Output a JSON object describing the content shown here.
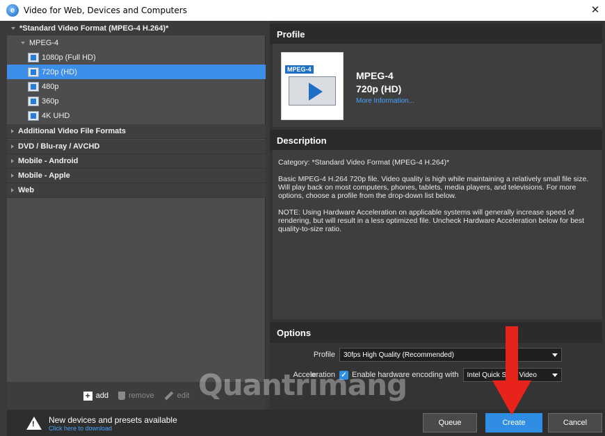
{
  "window": {
    "title": "Video for Web, Devices and Computers"
  },
  "tree": {
    "category_main": "*Standard Video Format (MPEG-4 H.264)*",
    "group": "MPEG-4",
    "presets": [
      "1080p (Full HD)",
      "720p (HD)",
      "480p",
      "360p",
      "4K UHD"
    ],
    "selected_index": 1,
    "other_categories": [
      "Additional Video File Formats",
      "DVD / Blu-ray / AVCHD",
      "Mobile - Android",
      "Mobile - Apple",
      "Web"
    ]
  },
  "left_footer": {
    "add": "add",
    "remove": "remove",
    "edit": "edit"
  },
  "profile": {
    "header": "Profile",
    "thumb_label": "MPEG-4",
    "name": "MPEG-4",
    "subname": "720p (HD)",
    "more_link": "More Information..."
  },
  "description": {
    "header": "Description",
    "category": "Category: *Standard Video Format (MPEG-4 H.264)*",
    "body": "Basic MPEG-4 H.264 720p file. Video quality is high while maintaining a relatively small file size. Will play back on most computers, phones, tablets, media players, and televisions. For more options, choose a profile from the drop-down list below.",
    "note": "NOTE: Using Hardware Acceleration on applicable systems will generally increase speed of rendering, but will result in a less optimized file. Uncheck Hardware Acceleration below for best quality-to-size ratio."
  },
  "options": {
    "header": "Options",
    "profile_label": "Profile",
    "profile_value": "30fps High Quality (Recommended)",
    "accel_label": "Acceleration",
    "accel_checked": true,
    "accel_text": "Enable hardware encoding with",
    "accel_value": "Intel Quick Sync Video"
  },
  "bottom": {
    "notice_title": "New devices and presets available",
    "notice_link": "Click here to download",
    "queue": "Queue",
    "create": "Create",
    "cancel": "Cancel"
  },
  "watermark": "Quantrimang",
  "colors": {
    "accent": "#2f8de4",
    "arrow": "#e8231c"
  }
}
